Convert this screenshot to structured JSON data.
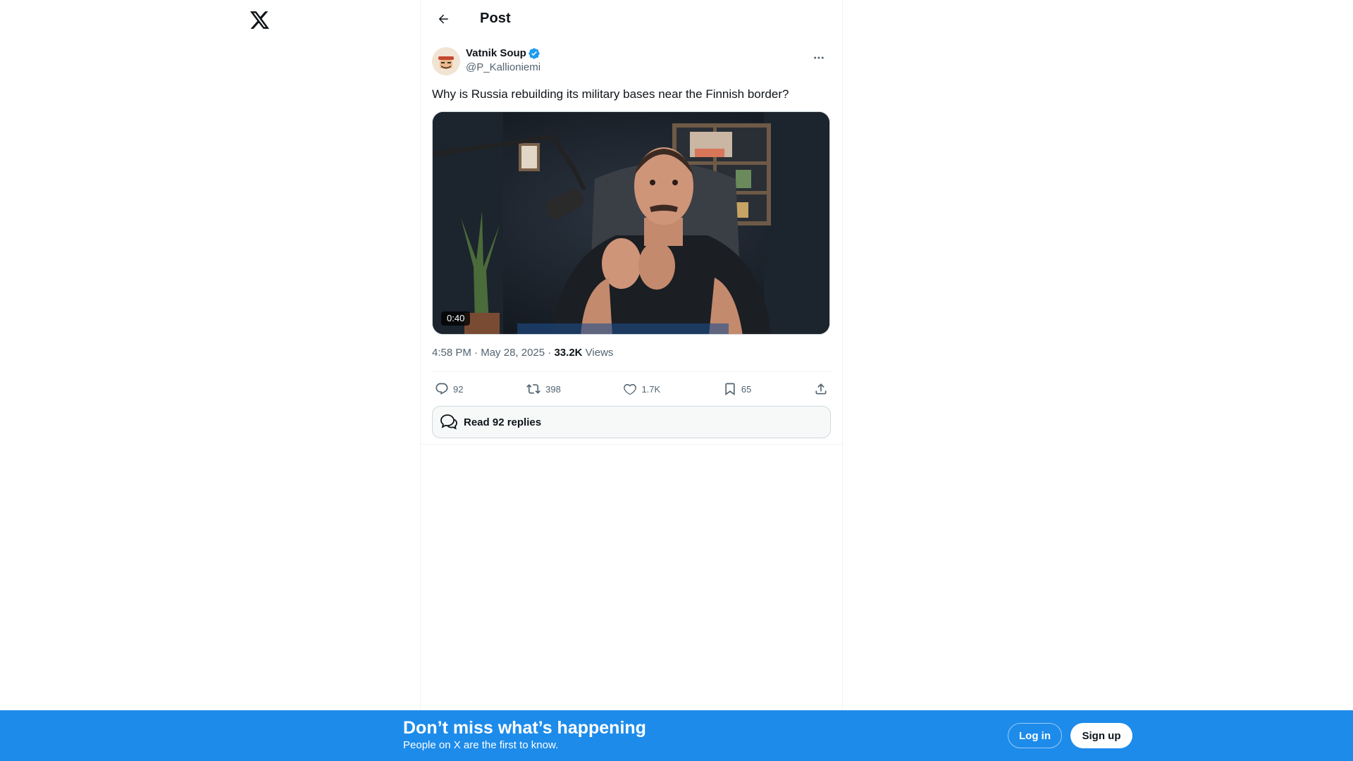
{
  "logo": {
    "icon": "x-logo-icon"
  },
  "header": {
    "title": "Post",
    "back_icon": "arrow-left-icon"
  },
  "post": {
    "author": {
      "display_name": "Vatnik Soup",
      "handle": "@P_Kallioniemi",
      "verified": true,
      "verified_color": "#1d9bf0"
    },
    "text": "Why is Russia rebuilding its military bases near the Finnish border?",
    "media": {
      "type": "video",
      "duration": "0:40"
    },
    "time": "4:58 PM",
    "separator": "·",
    "date": "May 28, 2025",
    "views_count": "33.2K",
    "views_label": "Views",
    "actions": {
      "replies": "92",
      "reposts": "398",
      "likes": "1.7K",
      "bookmarks": "65"
    },
    "read_replies_label": "Read 92 replies"
  },
  "banner": {
    "title": "Don’t miss what’s happening",
    "subtitle": "People on X are the first to know.",
    "login_label": "Log in",
    "signup_label": "Sign up",
    "background": "#1d8bea"
  }
}
